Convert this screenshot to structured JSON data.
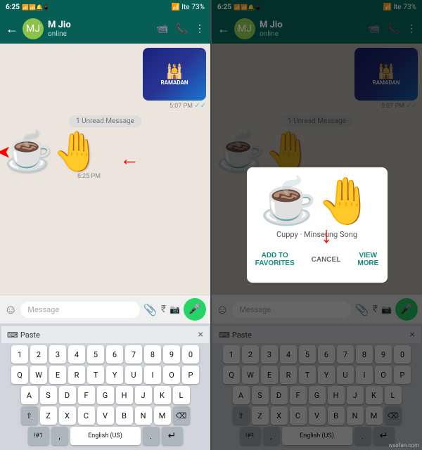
{
  "status_bar": {
    "time": "6:25",
    "battery": "73%",
    "signal": "lte",
    "icons_left": [
      "📶",
      "📶",
      "🔔",
      "📱"
    ],
    "icons_right": [
      "📶",
      "lte",
      "73%"
    ]
  },
  "header": {
    "contact_name": "M Jio",
    "contact_status": "online",
    "back_icon": "←",
    "video_icon": "📹",
    "call_icon": "📞",
    "menu_icon": "⋮"
  },
  "chat": {
    "ramadan_sticker_time": "5:07 PM",
    "unread_label": "1 Unread Message",
    "cuppy_sticker_time": "6:25 PM",
    "message_placeholder": "Message"
  },
  "keyboard": {
    "paste_label": "Paste",
    "close_icon": "×",
    "rows": [
      [
        "1",
        "2",
        "3",
        "4",
        "5",
        "6",
        "7",
        "8",
        "9",
        "0"
      ],
      [
        "Q",
        "W",
        "E",
        "R",
        "T",
        "Y",
        "U",
        "I",
        "O",
        "P"
      ],
      [
        "A",
        "S",
        "D",
        "F",
        "G",
        "H",
        "J",
        "K",
        "L"
      ],
      [
        "⇧",
        "Z",
        "X",
        "C",
        "V",
        "B",
        "N",
        "M",
        "⌫"
      ],
      [
        "!#1",
        "<",
        "English (US)",
        ">",
        "↵"
      ]
    ]
  },
  "modal": {
    "sticker_emoji": "☕",
    "sticker_name": "Cuppy",
    "sticker_author": "Minseung Song",
    "add_to_favorites_label": "ADD TO FAVORITES",
    "cancel_label": "CANCEL",
    "view_more_label": "VIEW MORE"
  },
  "input_bar": {
    "emoji_icon": "☺",
    "mic_icon": "🎤",
    "attach_icon": "📎",
    "camera_icon": "📷",
    "rupee_icon": "₹"
  }
}
